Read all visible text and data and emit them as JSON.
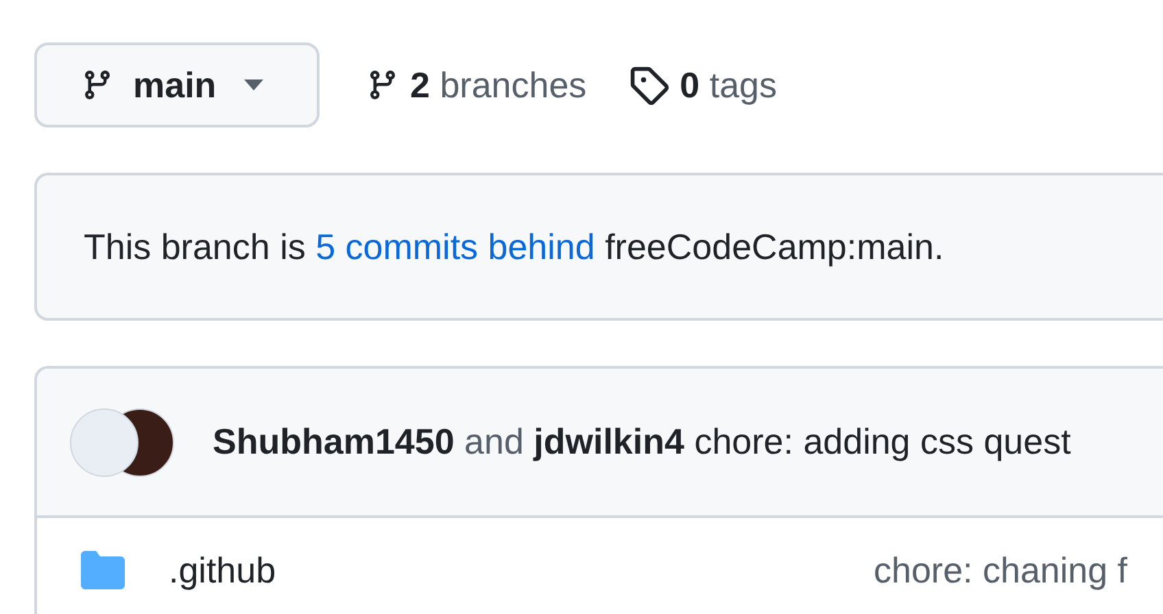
{
  "branch_selector": {
    "label": "main"
  },
  "branches": {
    "count": "2",
    "label": "branches"
  },
  "tags": {
    "count": "0",
    "label": "tags"
  },
  "notice": {
    "before": "This branch is",
    "link": "5 commits behind",
    "after": "freeCodeCamp:main."
  },
  "latest_commit": {
    "authors": [
      "Shubham1450",
      "jdwilkin4"
    ],
    "joiner": "and",
    "message": "chore: adding css quest"
  },
  "files": [
    {
      "kind": "folder",
      "name": ".github",
      "message": "chore: chaning f"
    }
  ]
}
